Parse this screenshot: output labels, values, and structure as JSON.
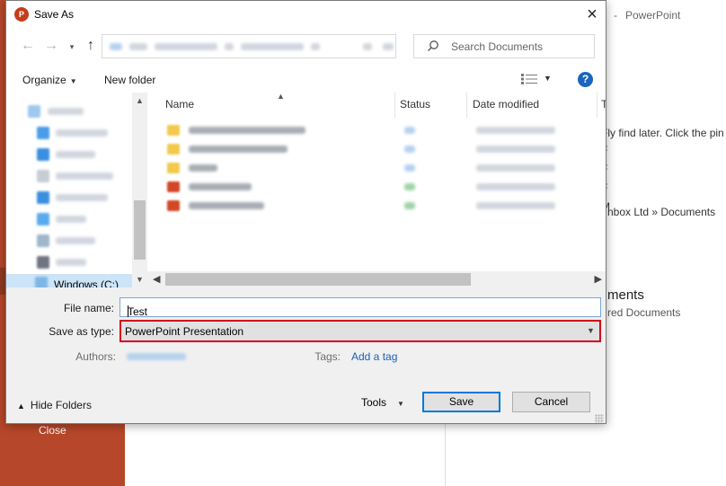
{
  "background": {
    "app_title": "PowerPoint",
    "close_label": "Close",
    "hint_text": "Fly find later. Click the pin",
    "letters": [
      "F",
      "F",
      "F",
      "M",
      "M"
    ],
    "location": "nbox Ltd » Documents",
    "heading": "ments",
    "subheading": "red Documents"
  },
  "dialog": {
    "title": "Save As",
    "app_icon": "P",
    "nav": {
      "back_icon": "←",
      "forward_icon": "→",
      "up_icon": "↑",
      "search_placeholder": "Search Documents"
    },
    "toolbar": {
      "organize_label": "Organize",
      "new_folder_label": "New folder",
      "help_label": "?"
    },
    "tree": {
      "selected_label": "Windows (C:)"
    },
    "columns": {
      "name": "Name",
      "status": "Status",
      "date_modified": "Date modified",
      "type": "T"
    },
    "form": {
      "file_name_label": "File name:",
      "file_name_value": "Test",
      "save_type_label": "Save as type:",
      "save_type_value": "PowerPoint Presentation",
      "authors_label": "Authors:",
      "tags_label": "Tags:",
      "tags_link": "Add a tag"
    },
    "footer": {
      "hide_folders_label": "Hide Folders",
      "tools_label": "Tools",
      "save_label": "Save",
      "cancel_label": "Cancel"
    }
  }
}
